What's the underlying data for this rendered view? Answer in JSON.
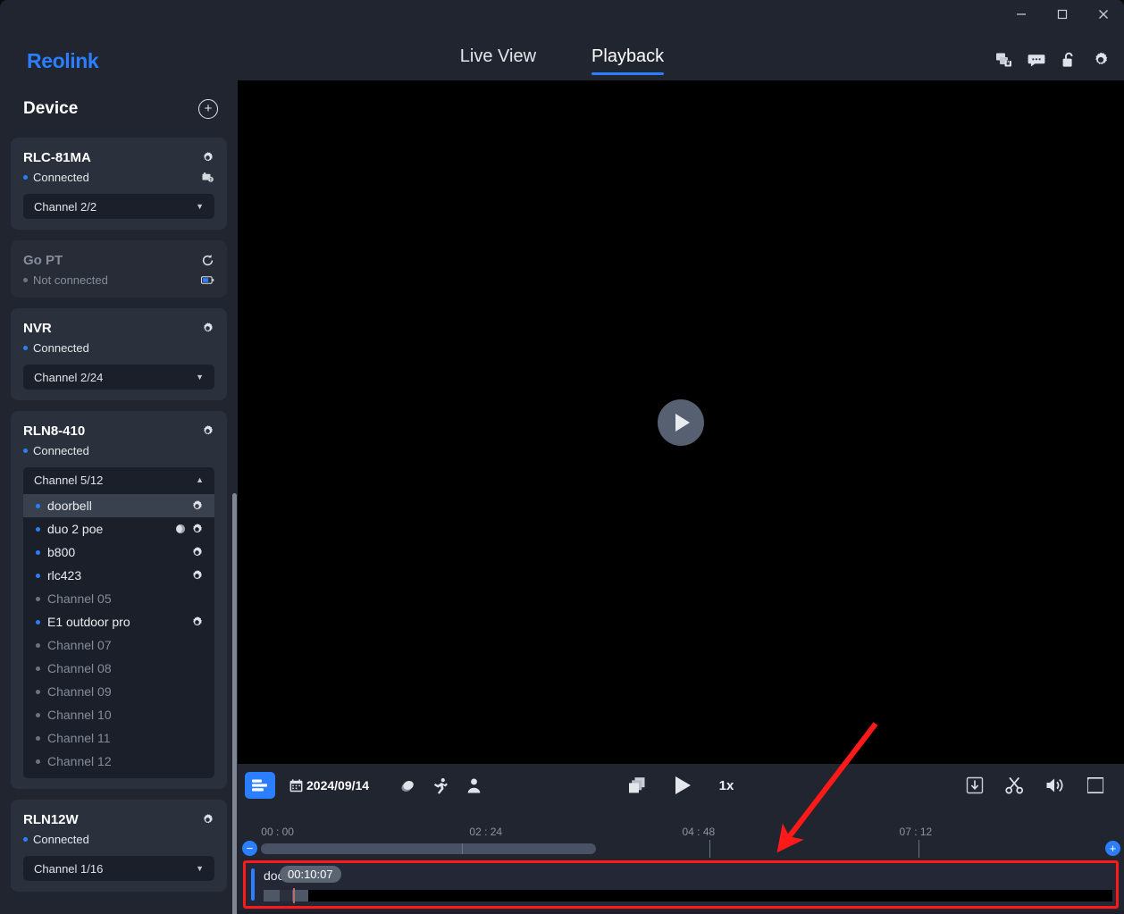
{
  "window": {
    "minimize_label": "Minimize",
    "maximize_label": "Maximize",
    "close_label": "Close"
  },
  "header": {
    "logo": "Reolink",
    "tabs": [
      {
        "label": "Live View",
        "active": false
      },
      {
        "label": "Playback",
        "active": true
      }
    ],
    "icons": [
      "files-lock-icon",
      "chat-icon",
      "unlock-icon",
      "gear-icon"
    ],
    "accent_color": "#2b7fff"
  },
  "sidebar": {
    "title": "Device",
    "add_label": "+",
    "devices": [
      {
        "name": "RLC-81MA",
        "status": "Connected",
        "connected": true,
        "channel": "Channel 2/2",
        "expanded": false,
        "right_icon": "gear-icon",
        "secondary_icon": "sd-card-icon"
      },
      {
        "name": "Go PT",
        "status": "Not connected",
        "connected": false,
        "channel": null,
        "expanded": false,
        "right_icon": "refresh-icon",
        "secondary_icon": "battery-icon"
      },
      {
        "name": "NVR",
        "status": "Connected",
        "connected": true,
        "channel": "Channel 2/24",
        "expanded": false,
        "right_icon": "gear-icon",
        "secondary_icon": null
      },
      {
        "name": "RLN8-410",
        "status": "Connected",
        "connected": true,
        "channel": "Channel 5/12",
        "expanded": true,
        "right_icon": "gear-icon",
        "secondary_icon": null,
        "channels": [
          {
            "label": "doorbell",
            "online": true,
            "selected": true,
            "gear": true,
            "moon": false
          },
          {
            "label": "duo 2 poe",
            "online": true,
            "selected": false,
            "gear": true,
            "moon": true
          },
          {
            "label": "b800",
            "online": true,
            "selected": false,
            "gear": true,
            "moon": false
          },
          {
            "label": "rlc423",
            "online": true,
            "selected": false,
            "gear": true,
            "moon": false
          },
          {
            "label": "Channel 05",
            "online": false,
            "selected": false,
            "gear": false,
            "moon": false
          },
          {
            "label": "E1 outdoor pro",
            "online": true,
            "selected": false,
            "gear": true,
            "moon": false
          },
          {
            "label": "Channel 07",
            "online": false,
            "selected": false,
            "gear": false,
            "moon": false
          },
          {
            "label": "Channel 08",
            "online": false,
            "selected": false,
            "gear": false,
            "moon": false
          },
          {
            "label": "Channel 09",
            "online": false,
            "selected": false,
            "gear": false,
            "moon": false
          },
          {
            "label": "Channel 10",
            "online": false,
            "selected": false,
            "gear": false,
            "moon": false
          },
          {
            "label": "Channel 11",
            "online": false,
            "selected": false,
            "gear": false,
            "moon": false
          },
          {
            "label": "Channel 12",
            "online": false,
            "selected": false,
            "gear": false,
            "moon": false
          }
        ]
      },
      {
        "name": "RLN12W",
        "status": "Connected",
        "connected": true,
        "channel": "Channel 1/16",
        "expanded": false,
        "right_icon": "gear-icon",
        "secondary_icon": null
      }
    ]
  },
  "video": {
    "play_label": "Play",
    "background": "#000000"
  },
  "controls": {
    "list_toggle": "list-view-icon",
    "date": "2024/09/14",
    "filters": [
      {
        "name": "normal-record-icon",
        "label": "Normal"
      },
      {
        "name": "motion-detect-icon",
        "label": "Motion"
      },
      {
        "name": "person-detect-icon",
        "label": "Person"
      }
    ],
    "multi_view": "multi-window-icon",
    "play": "play-icon",
    "speed": "1x",
    "download": "download-icon",
    "clip": "scissors-icon",
    "volume": "volume-icon",
    "fullscreen": "fullscreen-icon"
  },
  "timeline": {
    "ticks": [
      "00 : 00",
      "02 : 24",
      "04 : 48",
      "07 : 12"
    ],
    "tick_positions_pct": [
      4.5,
      28.0,
      52.0,
      76.5
    ],
    "zoom_out_label": "−",
    "zoom_in_label": "+",
    "scroll_thumb_pct": 43,
    "tracks": [
      {
        "name": "doorbell",
        "tooltip": "00:10:07",
        "accent_color": "#2b7fff"
      }
    ]
  },
  "annotation": {
    "arrow_color": "#ff1a1a",
    "highlight_color": "#ff1a1a"
  }
}
